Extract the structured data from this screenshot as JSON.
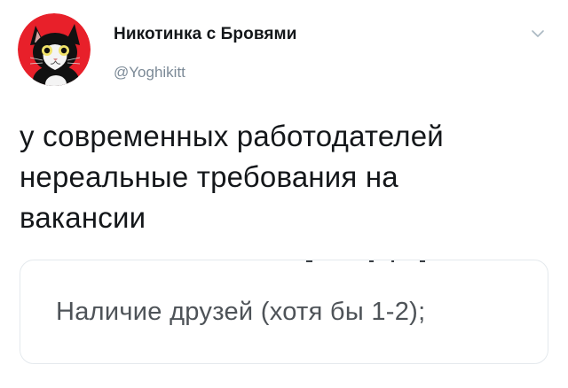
{
  "tweet": {
    "author": {
      "display_name": "Никотинка с Бровями",
      "handle": "@Yoghikitt",
      "avatar_icon": "cat-avatar-icon"
    },
    "menu_icon": "chevron-down-icon",
    "text": "у современных работодателей\nнереальные требования на\nвакансии",
    "quoted_card": {
      "text": "Наличие друзей (хотя бы 1-2);"
    }
  },
  "colors": {
    "avatar_background": "#e8202a",
    "handle": "#7c8a97",
    "card_border": "#e4e9ed",
    "card_text": "#4e5358"
  }
}
